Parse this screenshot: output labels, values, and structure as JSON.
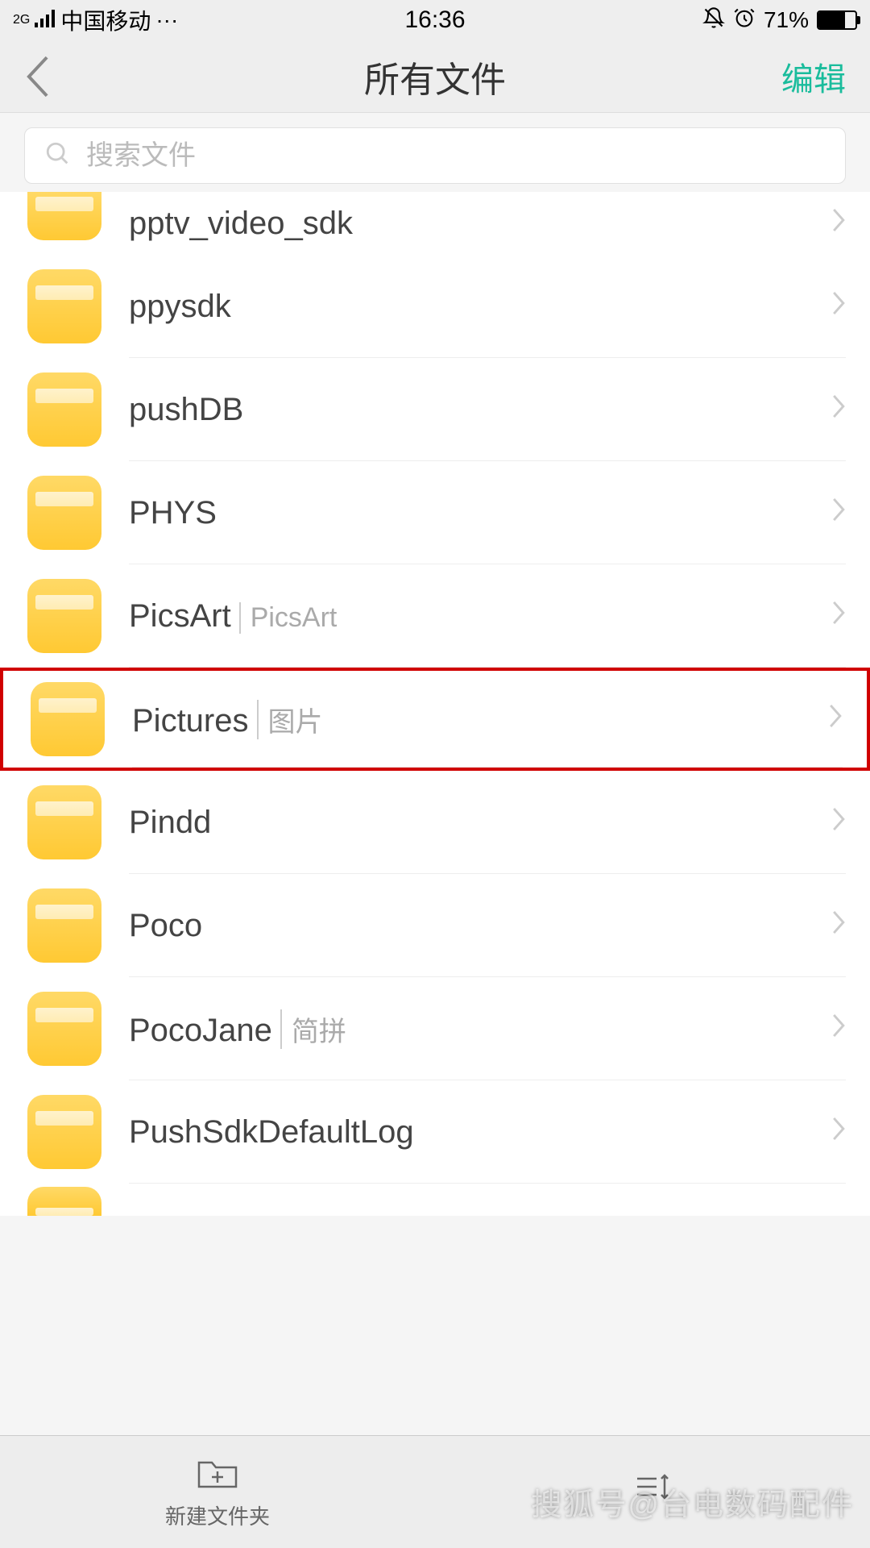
{
  "statusbar": {
    "network_label": "中国移动",
    "network_type": "2G",
    "time": "16:36",
    "battery_pct": "71%"
  },
  "header": {
    "title": "所有文件",
    "edit": "编辑"
  },
  "search": {
    "placeholder": "搜索文件"
  },
  "files": [
    {
      "name": "pptv_video_sdk",
      "sub": "",
      "partial": "top"
    },
    {
      "name": "ppysdk",
      "sub": ""
    },
    {
      "name": "pushDB",
      "sub": ""
    },
    {
      "name": "PHYS",
      "sub": ""
    },
    {
      "name": "PicsArt",
      "sub": "PicsArt"
    },
    {
      "name": "Pictures",
      "sub": "图片",
      "highlighted": true
    },
    {
      "name": "Pindd",
      "sub": ""
    },
    {
      "name": "Poco",
      "sub": ""
    },
    {
      "name": "PocoJane",
      "sub": "简拼"
    },
    {
      "name": "PushSdkDefaultLog",
      "sub": ""
    },
    {
      "name": "",
      "sub": "",
      "partial": "bottom"
    }
  ],
  "bottombar": {
    "new_folder": "新建文件夹",
    "sort": ""
  },
  "watermark": "搜狐号@台电数码配件"
}
